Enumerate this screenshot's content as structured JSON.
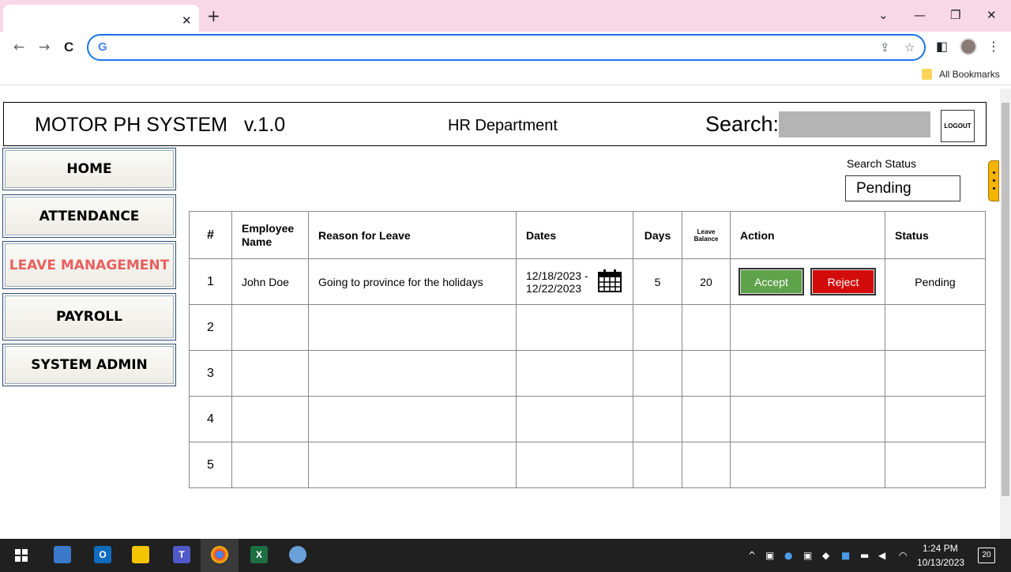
{
  "browser": {
    "close_tab": "✕",
    "new_tab": "+",
    "win_controls": [
      "⌄",
      "—",
      "❐",
      "✕"
    ],
    "back": "←",
    "forward": "→",
    "reload": "C",
    "google_logo": "G",
    "share": "⇪",
    "star": "☆",
    "sidepanel": "◧",
    "menu": "⋮",
    "bookmarks_label": "All Bookmarks"
  },
  "app": {
    "title": "MOTOR PH SYSTEM   v.1.0",
    "department": "HR Department",
    "search_label": "Search:",
    "search_value": "",
    "logout_label": "LOGOUT"
  },
  "sidebar": {
    "items": [
      {
        "label": "HOME",
        "active": false
      },
      {
        "label": "ATTENDANCE",
        "active": false
      },
      {
        "label": "LEAVE MANAGEMENT",
        "active": true
      },
      {
        "label": "PAYROLL",
        "active": false
      },
      {
        "label": "SYSTEM ADMIN",
        "active": false
      }
    ]
  },
  "filter": {
    "caption": "Search Status",
    "value": "Pending"
  },
  "table": {
    "headers": {
      "num": "#",
      "employee": "Employee Name",
      "reason": "Reason for Leave",
      "dates": "Dates",
      "days": "Days",
      "balance": "Leave Balance",
      "action": "Action",
      "status": "Status"
    },
    "rows": [
      {
        "num": "1",
        "employee": "John Doe",
        "reason": "Going to province for the holidays",
        "date_from": "12/18/2023 -",
        "date_to": "12/22/2023",
        "days": "5",
        "balance": "20",
        "accept": "Accept",
        "reject": "Reject",
        "status": "Pending"
      },
      {
        "num": "2"
      },
      {
        "num": "3"
      },
      {
        "num": "4"
      },
      {
        "num": "5"
      }
    ]
  },
  "taskbar": {
    "time": "1:24 PM",
    "date": "10/13/2023",
    "notifications": "20"
  },
  "colors": {
    "accept": "#5ea24a",
    "reject": "#d40b0b",
    "active_nav": "#e86060",
    "status_tab": "#f4b400"
  }
}
